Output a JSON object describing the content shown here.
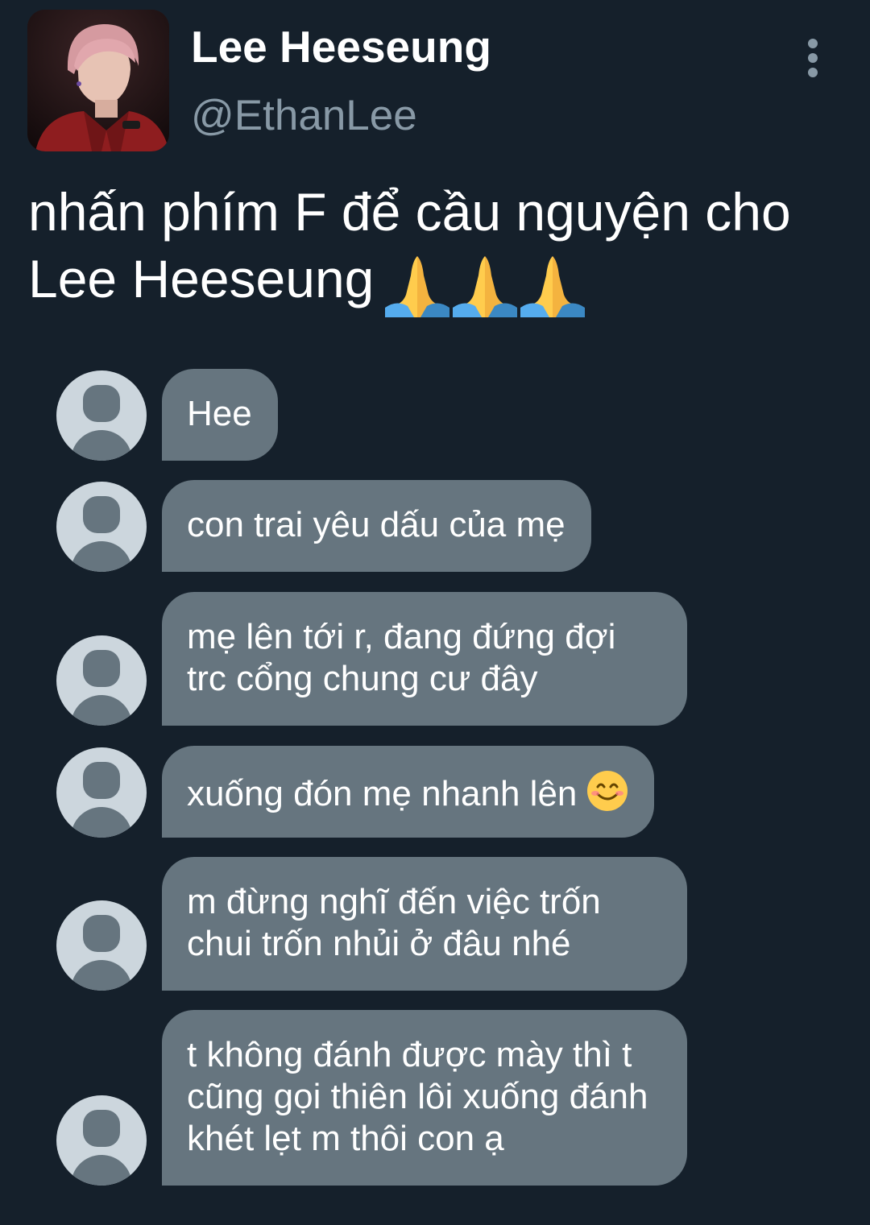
{
  "header": {
    "display_name": "Lee Heeseung",
    "handle": "@EthanLee",
    "avatar_icon": "profile-photo",
    "menu_icon": "more-vertical-icon"
  },
  "tweet": {
    "text": "nhấn phím F để cầu nguyện cho Lee Heeseung",
    "emoji": "🙏🙏🙏"
  },
  "chat": {
    "messages": [
      {
        "text": "Hee"
      },
      {
        "text": "con trai yêu dấu của mẹ"
      },
      {
        "lines": [
          "mẹ lên tới r, đang đứng đợi",
          "trc cổng chung cư đây"
        ]
      },
      {
        "text": "xuống đón mẹ nhanh lên",
        "emoji": "😊"
      },
      {
        "lines": [
          "m đừng nghĩ đến việc trốn",
          "chui trốn nhủi ở đâu nhé"
        ]
      },
      {
        "lines": [
          "t không đánh được mày thì t",
          "cũng gọi thiên lôi xuống đánh",
          "khét lẹt m thôi con ạ"
        ]
      }
    ]
  },
  "colors": {
    "background": "#15202b",
    "bubble": "#66757f",
    "avatar_bg": "#ccd6dd",
    "secondary_text": "#8899a6"
  }
}
